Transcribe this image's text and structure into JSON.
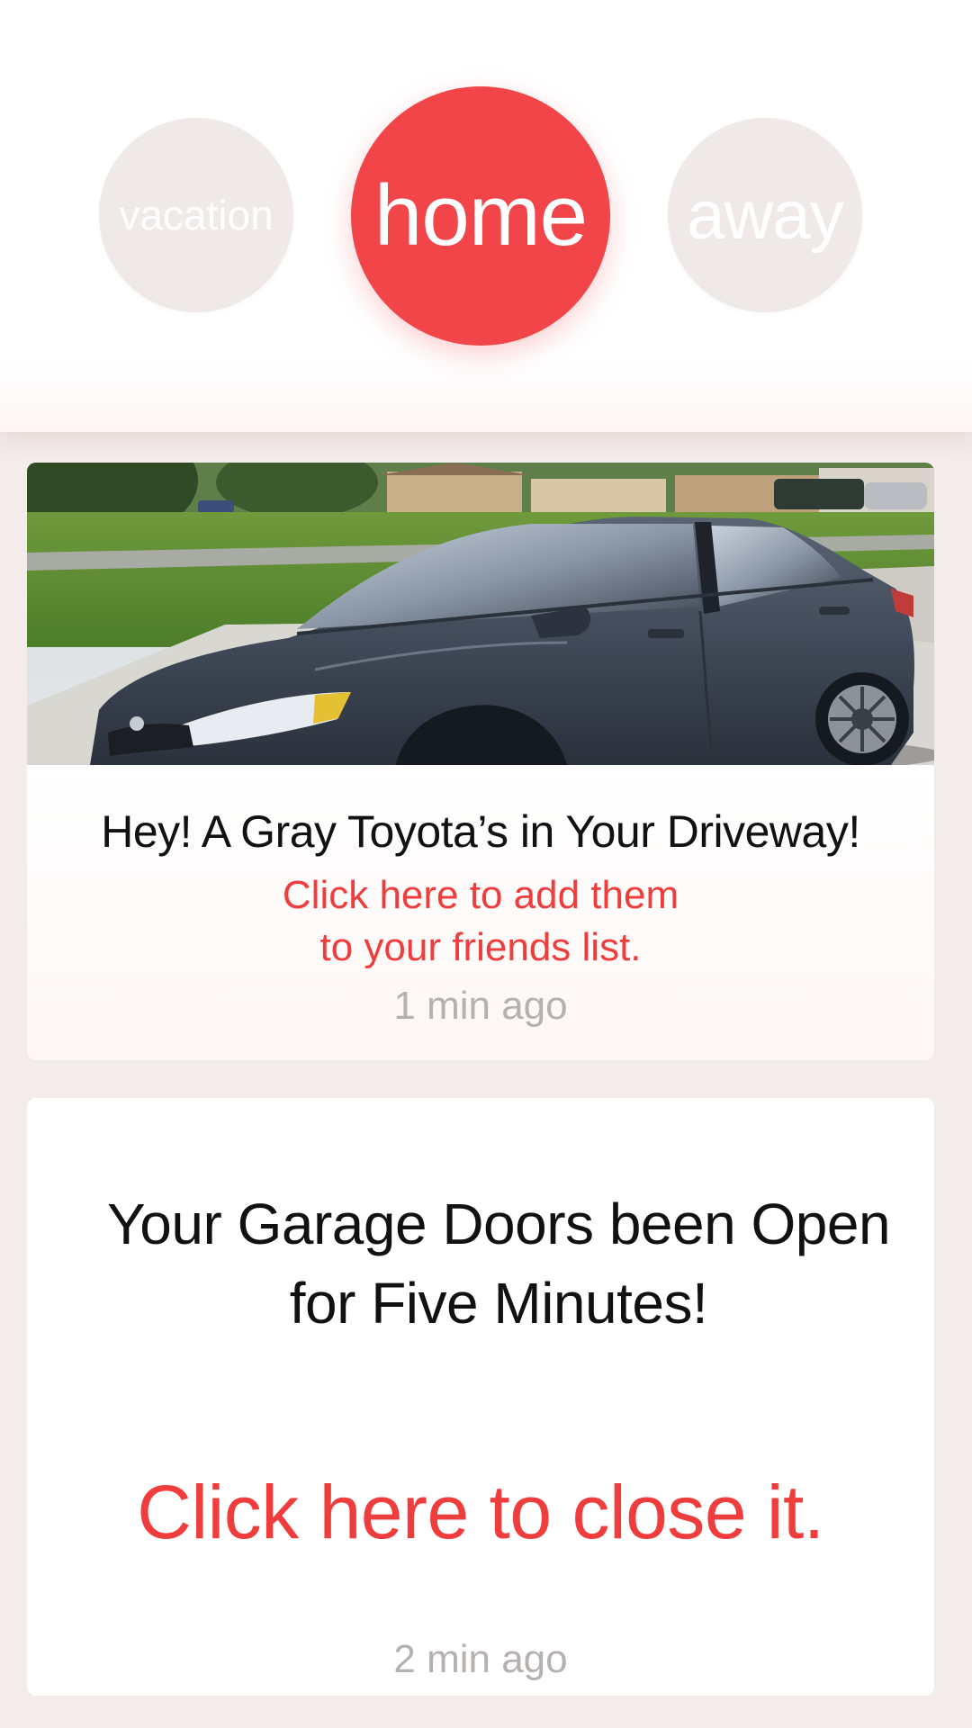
{
  "modes": {
    "vacation": "vacation",
    "home": "home",
    "away": "away",
    "selected": "home"
  },
  "colors": {
    "accent": "#f24549",
    "link": "#ef3d3d",
    "inactive_mode": "#efeae7",
    "muted_text": "#b6b0ae",
    "background": "#f4ecea"
  },
  "notifications": [
    {
      "image": "gray-toyota-in-driveway-photo",
      "title": "Hey! A Gray Toyota’s in Your Driveway!",
      "link_line1": "Click here to add them",
      "link_line2": "to your friends list.",
      "time": "1 min ago"
    },
    {
      "title_line1": "Your Garage Doors been Open",
      "title_line2": "for Five Minutes!",
      "link": "Click here to close it.",
      "time": "2 min ago"
    }
  ]
}
